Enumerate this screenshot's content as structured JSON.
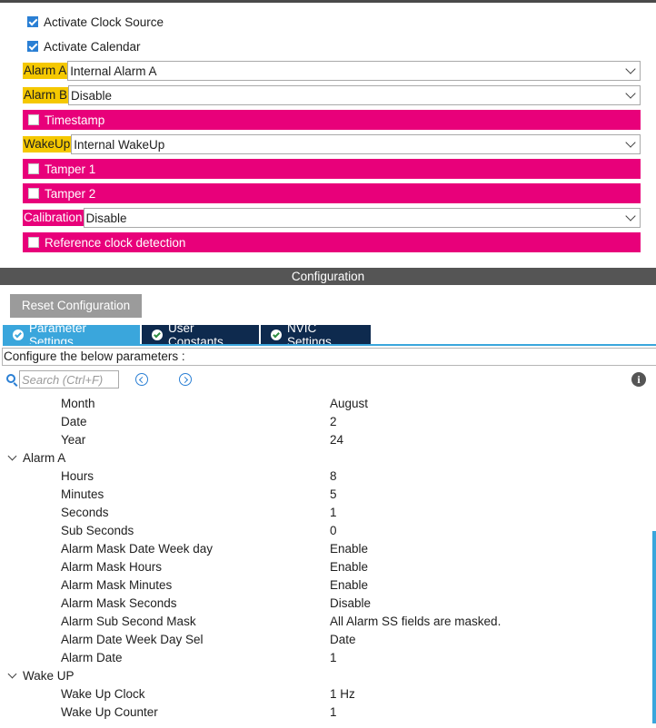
{
  "modes": {
    "activate_clock_source": {
      "label": "Activate Clock Source",
      "checked": true
    },
    "activate_calendar": {
      "label": "Activate Calendar",
      "checked": true
    },
    "alarm_a": {
      "label": "Alarm A",
      "value": "Internal Alarm A"
    },
    "alarm_b": {
      "label": "Alarm B",
      "value": "Disable"
    },
    "timestamp": {
      "label": "Timestamp",
      "checked": false
    },
    "wakeup": {
      "label": "WakeUp",
      "value": "Internal WakeUp"
    },
    "tamper1": {
      "label": "Tamper 1",
      "checked": false
    },
    "tamper2": {
      "label": "Tamper 2",
      "checked": false
    },
    "calibration": {
      "label": "Calibration",
      "value": "Disable"
    },
    "reference_clock": {
      "label": "Reference clock detection",
      "checked": false
    }
  },
  "configuration": {
    "title": "Configuration",
    "reset_label": "Reset Configuration",
    "tabs": [
      {
        "label": "Parameter Settings",
        "active": true
      },
      {
        "label": "User Constants",
        "active": false
      },
      {
        "label": "NVIC Settings",
        "active": false
      }
    ],
    "header": "Configure the below parameters :",
    "search_placeholder": "Search (Ctrl+F)"
  },
  "params": {
    "month": {
      "name": "Month",
      "value": "August"
    },
    "date": {
      "name": "Date",
      "value": "2"
    },
    "year": {
      "name": "Year",
      "value": "24"
    },
    "alarm_a_group": "Alarm A",
    "hours": {
      "name": "Hours",
      "value": "8"
    },
    "minutes": {
      "name": "Minutes",
      "value": "5"
    },
    "seconds": {
      "name": "Seconds",
      "value": "1"
    },
    "sub_seconds": {
      "name": "Sub Seconds",
      "value": "0"
    },
    "mask_date_week_day": {
      "name": "Alarm Mask Date Week day",
      "value": "Enable"
    },
    "mask_hours": {
      "name": "Alarm Mask Hours",
      "value": "Enable"
    },
    "mask_minutes": {
      "name": "Alarm Mask Minutes",
      "value": "Enable"
    },
    "mask_seconds": {
      "name": "Alarm Mask Seconds",
      "value": "Disable"
    },
    "sub_second_mask": {
      "name": "Alarm Sub Second Mask",
      "value": "All Alarm SS fields are masked."
    },
    "date_week_day_sel": {
      "name": "Alarm Date Week Day Sel",
      "value": "Date"
    },
    "alarm_date": {
      "name": "Alarm Date",
      "value": "1"
    },
    "wake_up_group": "Wake UP",
    "wake_up_clock": {
      "name": "Wake Up Clock",
      "value": "1 Hz"
    },
    "wake_up_counter": {
      "name": "Wake Up Counter",
      "value": "1"
    }
  },
  "colors": {
    "highlight_yellow": "#f5c800",
    "highlight_pink": "#e8007a",
    "tab_active": "#3aa6dc",
    "tab_inactive": "#0e2a4e",
    "config_bar": "#555555"
  }
}
